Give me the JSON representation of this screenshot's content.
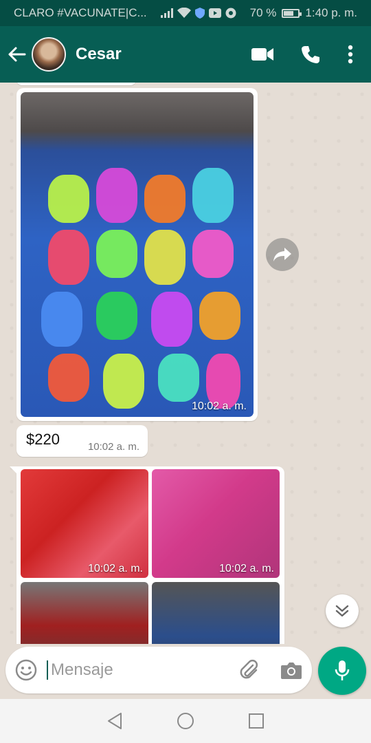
{
  "status_bar": {
    "carrier": "CLARO #VACUNATE|C...",
    "battery_text": "70 %",
    "battery_level": 0.7,
    "time": "1:40 p. m."
  },
  "header": {
    "contact_name": "Cesar",
    "icons": [
      "back-arrow-icon",
      "video-call-icon",
      "phone-icon",
      "more-options-icon"
    ]
  },
  "messages": [
    {
      "type": "image",
      "timestamp": "10:02 a. m."
    },
    {
      "type": "text",
      "text": "$220",
      "timestamp": "10:02 a. m."
    },
    {
      "type": "album",
      "timestamps": [
        "10:02 a. m.",
        "10:02 a. m."
      ]
    }
  ],
  "composer": {
    "placeholder": "Mensaje",
    "icons": [
      "emoji-icon",
      "attach-icon",
      "camera-icon",
      "mic-icon"
    ]
  },
  "colors": {
    "header": "#075e54",
    "status_bar": "#054d44",
    "accent": "#00a884",
    "chat_background": "#e5ddd5"
  }
}
